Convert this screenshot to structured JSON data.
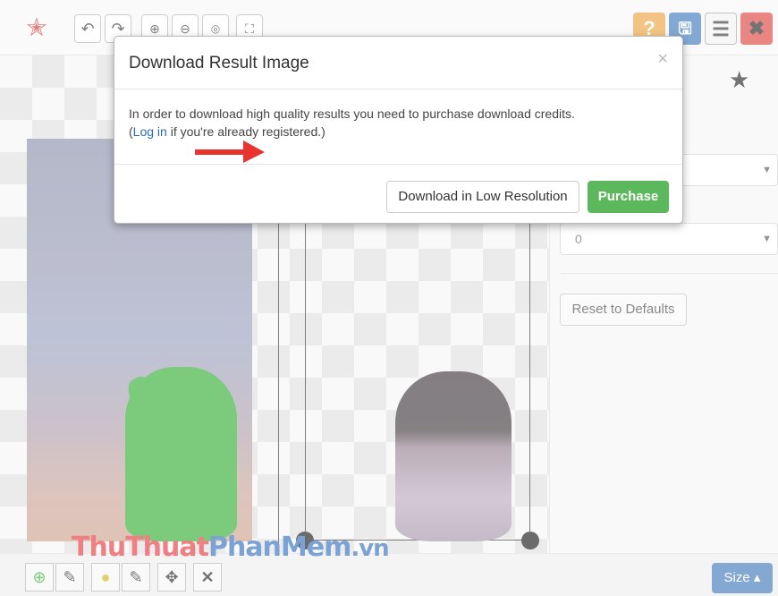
{
  "toolbar": {
    "icons": [
      "logo-icon",
      "undo-icon",
      "redo-icon",
      "zoom-in-icon",
      "zoom-out-icon",
      "zoom-actual-icon",
      "zoom-fit-icon",
      "help-icon",
      "save-icon",
      "menu-icon",
      "close-icon"
    ],
    "help_glyph": "?",
    "save_glyph": "🖫",
    "menu_glyph": "☰",
    "close_glyph": "✖",
    "colors": {
      "help": "#e89a2c",
      "save": "#2a6ab0",
      "close": "#d9302a"
    }
  },
  "right_panel": {
    "select1_value": "",
    "select2_value": "0",
    "reset_label": "Reset to Defaults"
  },
  "bottom_bar": {
    "tools": [
      "add-foreground-icon",
      "eraser-icon",
      "mark-background-icon",
      "eraser-icon",
      "move-icon",
      "delete-icon"
    ],
    "size_label": "Size ▴"
  },
  "watermark": {
    "part1": "Thu",
    "part2": "Thuat",
    "part3": "PhanMem",
    "part4": ".vn"
  },
  "modal": {
    "title": "Download Result Image",
    "close": "×",
    "body_line1": "In order to download high quality results you need to purchase download credits.",
    "body_prefix": "(",
    "login_link": "Log in",
    "body_suffix": " if you're already registered.)",
    "low_res_label": "Download in Low Resolution",
    "purchase_label": "Purchase",
    "purchase_color": "#5cb85c",
    "arrow_color": "#e8332f"
  }
}
